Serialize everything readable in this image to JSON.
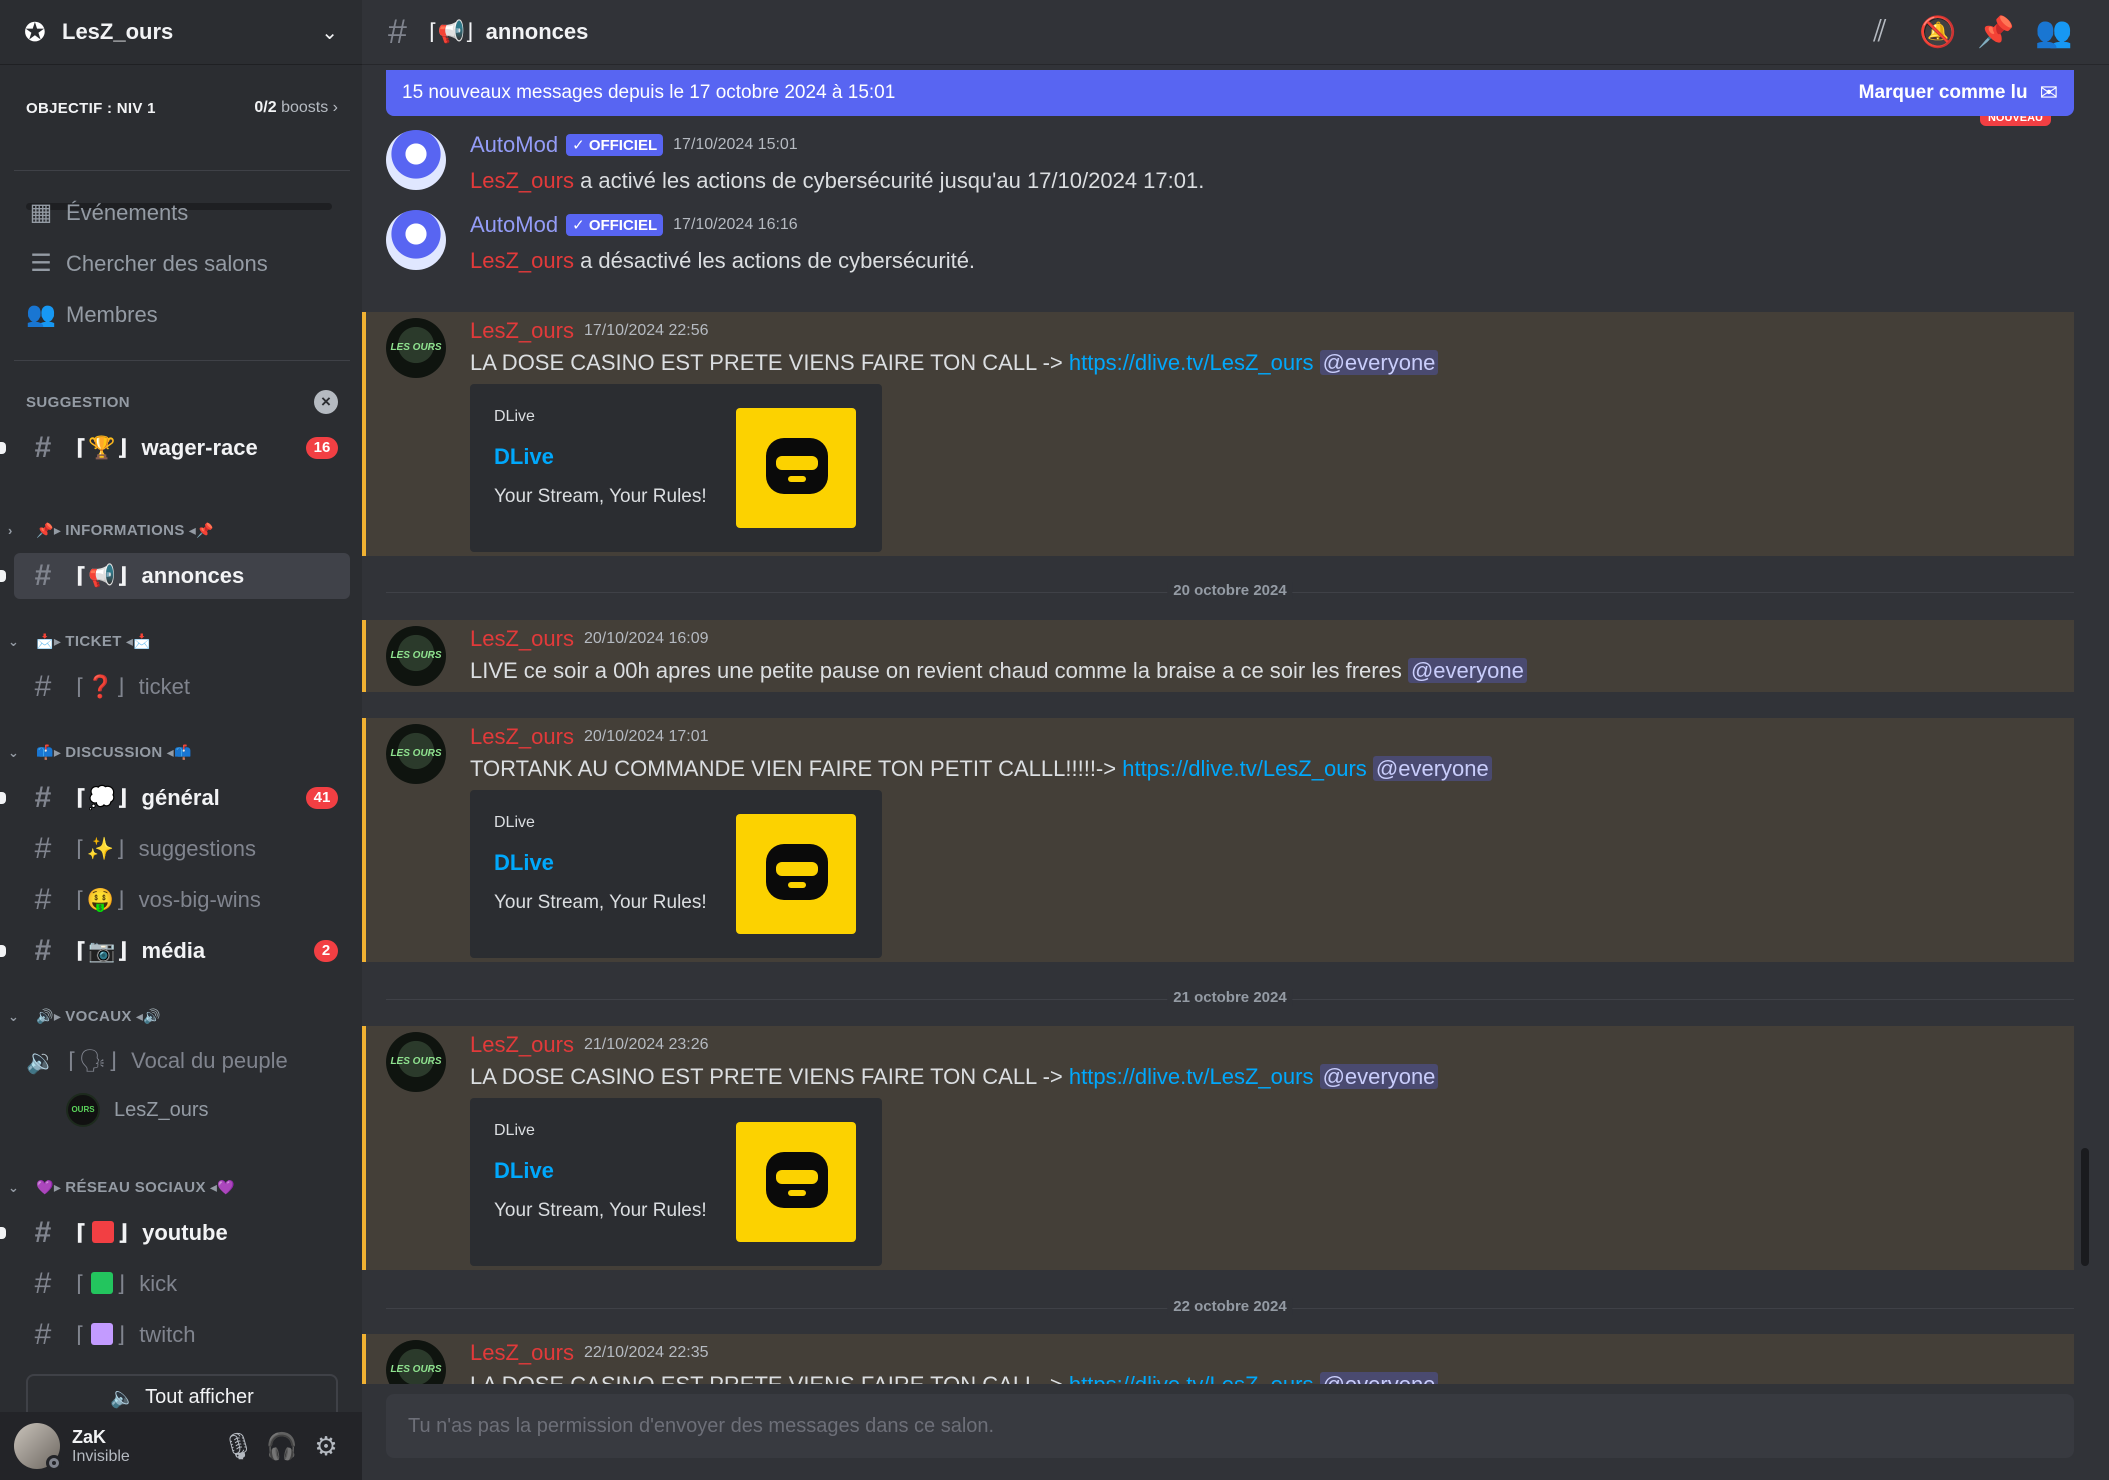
{
  "server": {
    "name": "LesZ_ours"
  },
  "boost": {
    "goal": "OBJECTIF : NIV 1",
    "count": "0/2",
    "unit": "boosts",
    "progress": 0
  },
  "nav": [
    {
      "label": "Événements",
      "icon": "calendar-icon"
    },
    {
      "label": "Chercher des salons",
      "icon": "channel-search-icon"
    },
    {
      "label": "Membres",
      "icon": "members-icon"
    }
  ],
  "categories": {
    "suggestion": "SUGGESTION",
    "informations": "INFORMATIONS",
    "ticket": "TICKET",
    "discussion": "DISCUSSION",
    "vocaux": "VOCAUX",
    "reseaux": "RÉSEAU SOCIAUX"
  },
  "channels": {
    "wager_race": {
      "label": "wager-race",
      "emoji": "🏆",
      "badge": "16"
    },
    "annonces": {
      "label": "annonces",
      "emoji": "📢"
    },
    "ticket": {
      "label": "ticket",
      "emoji": "❓"
    },
    "general": {
      "label": "général",
      "emoji": "💭",
      "badge": "41"
    },
    "suggestions": {
      "label": "suggestions",
      "emoji": "✨"
    },
    "vos_big_wins": {
      "label": "vos-big-wins",
      "emoji": "🤑"
    },
    "media": {
      "label": "média",
      "emoji": "📷",
      "badge": "2"
    },
    "vocal": {
      "label": "Vocal du peuple",
      "emoji": "🗣"
    },
    "youtube": {
      "label": "youtube",
      "color": "#f23f43"
    },
    "kick": {
      "label": "kick",
      "color": "#23c55e"
    },
    "twitch": {
      "label": "twitch",
      "color": "#c39bff"
    }
  },
  "voice_user": "LesZ_ours",
  "show_all": "Tout afficher",
  "user": {
    "name": "ZaK",
    "status": "Invisible"
  },
  "header": {
    "channel": "annonces",
    "emoji": "📢"
  },
  "new_messages": {
    "text": "15 nouveaux messages depuis le 17 octobre 2024 à 15:01",
    "mark_read": "Marquer comme lu",
    "nouveau": "NOUVEAU"
  },
  "messages": [
    {
      "author": "AutoMod",
      "tag": "OFFICIEL",
      "time": "17/10/2024 15:01",
      "mention": "LesZ_ours",
      "text": " a activé les actions de cybersécurité jusqu'au 17/10/2024 17:01."
    },
    {
      "author": "AutoMod",
      "tag": "OFFICIEL",
      "time": "17/10/2024 16:16",
      "mention": "LesZ_ours",
      "text": " a désactivé les actions de cybersécurité."
    },
    {
      "author": "LesZ_ours",
      "time": "17/10/2024 22:56",
      "text": "LA DOSE CASINO EST PRETE  VIENS FAIRE TON CALL -> ",
      "link": "https://dlive.tv/LesZ_ours",
      "ping": "@everyone"
    },
    {
      "author": "LesZ_ours",
      "time": "20/10/2024 16:09",
      "text": "LIVE ce soir a 00h apres une petite pause on revient chaud comme la braise a ce soir les freres ",
      "ping": "@everyone"
    },
    {
      "author": "LesZ_ours",
      "time": "20/10/2024 17:01",
      "text": "TORTANK AU COMMANDE VIEN FAIRE TON PETIT CALLL!!!!!-> ",
      "link": "https://dlive.tv/LesZ_ours",
      "ping": "@everyone"
    },
    {
      "author": "LesZ_ours",
      "time": "21/10/2024 23:26",
      "text": "LA DOSE CASINO EST PRETE  VIENS FAIRE TON CALL -> ",
      "link": "https://dlive.tv/LesZ_ours",
      "ping": "@everyone"
    },
    {
      "author": "LesZ_ours",
      "time": "22/10/2024 22:35",
      "text": "LA DOSE CASINO EST PRETE  VIENS FAIRE TON CALL -> ",
      "link": "https://dlive.tv/LesZ_ours",
      "ping": "@everyone"
    }
  ],
  "embed": {
    "provider": "DLive",
    "title": "DLive",
    "description": "Your Stream, Your Rules!"
  },
  "dates": [
    "20 octobre 2024",
    "21 octobre 2024",
    "22 octobre 2024"
  ],
  "composer": {
    "placeholder": "Tu n'as pas la permission d'envoyer des messages dans ce salon."
  }
}
